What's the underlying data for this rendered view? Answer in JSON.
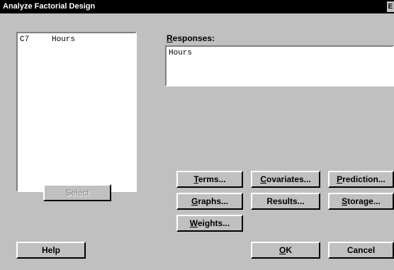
{
  "window": {
    "title": "Analyze Factorial Design",
    "close_glyph": "E"
  },
  "variables": [
    {
      "column": "C7",
      "name": "Hours"
    }
  ],
  "responses": {
    "label_prefix": "",
    "label_hotkey": "R",
    "label_rest": "esponses:",
    "value": "Hours"
  },
  "buttons": {
    "select": "Select",
    "terms": {
      "hotkey": "T",
      "rest": "erms..."
    },
    "covariates": {
      "hotkey": "C",
      "rest": "ovariates..."
    },
    "prediction": {
      "hotkey": "P",
      "rest": "rediction..."
    },
    "graphs": {
      "hotkey": "G",
      "rest": "raphs..."
    },
    "results": {
      "text": "Results..."
    },
    "storage": {
      "hotkey": "S",
      "rest": "torage..."
    },
    "weights": {
      "hotkey": "W",
      "rest": "eights..."
    },
    "help": "Help",
    "ok": {
      "hotkey": "O",
      "rest": "K"
    },
    "cancel": "Cancel"
  }
}
